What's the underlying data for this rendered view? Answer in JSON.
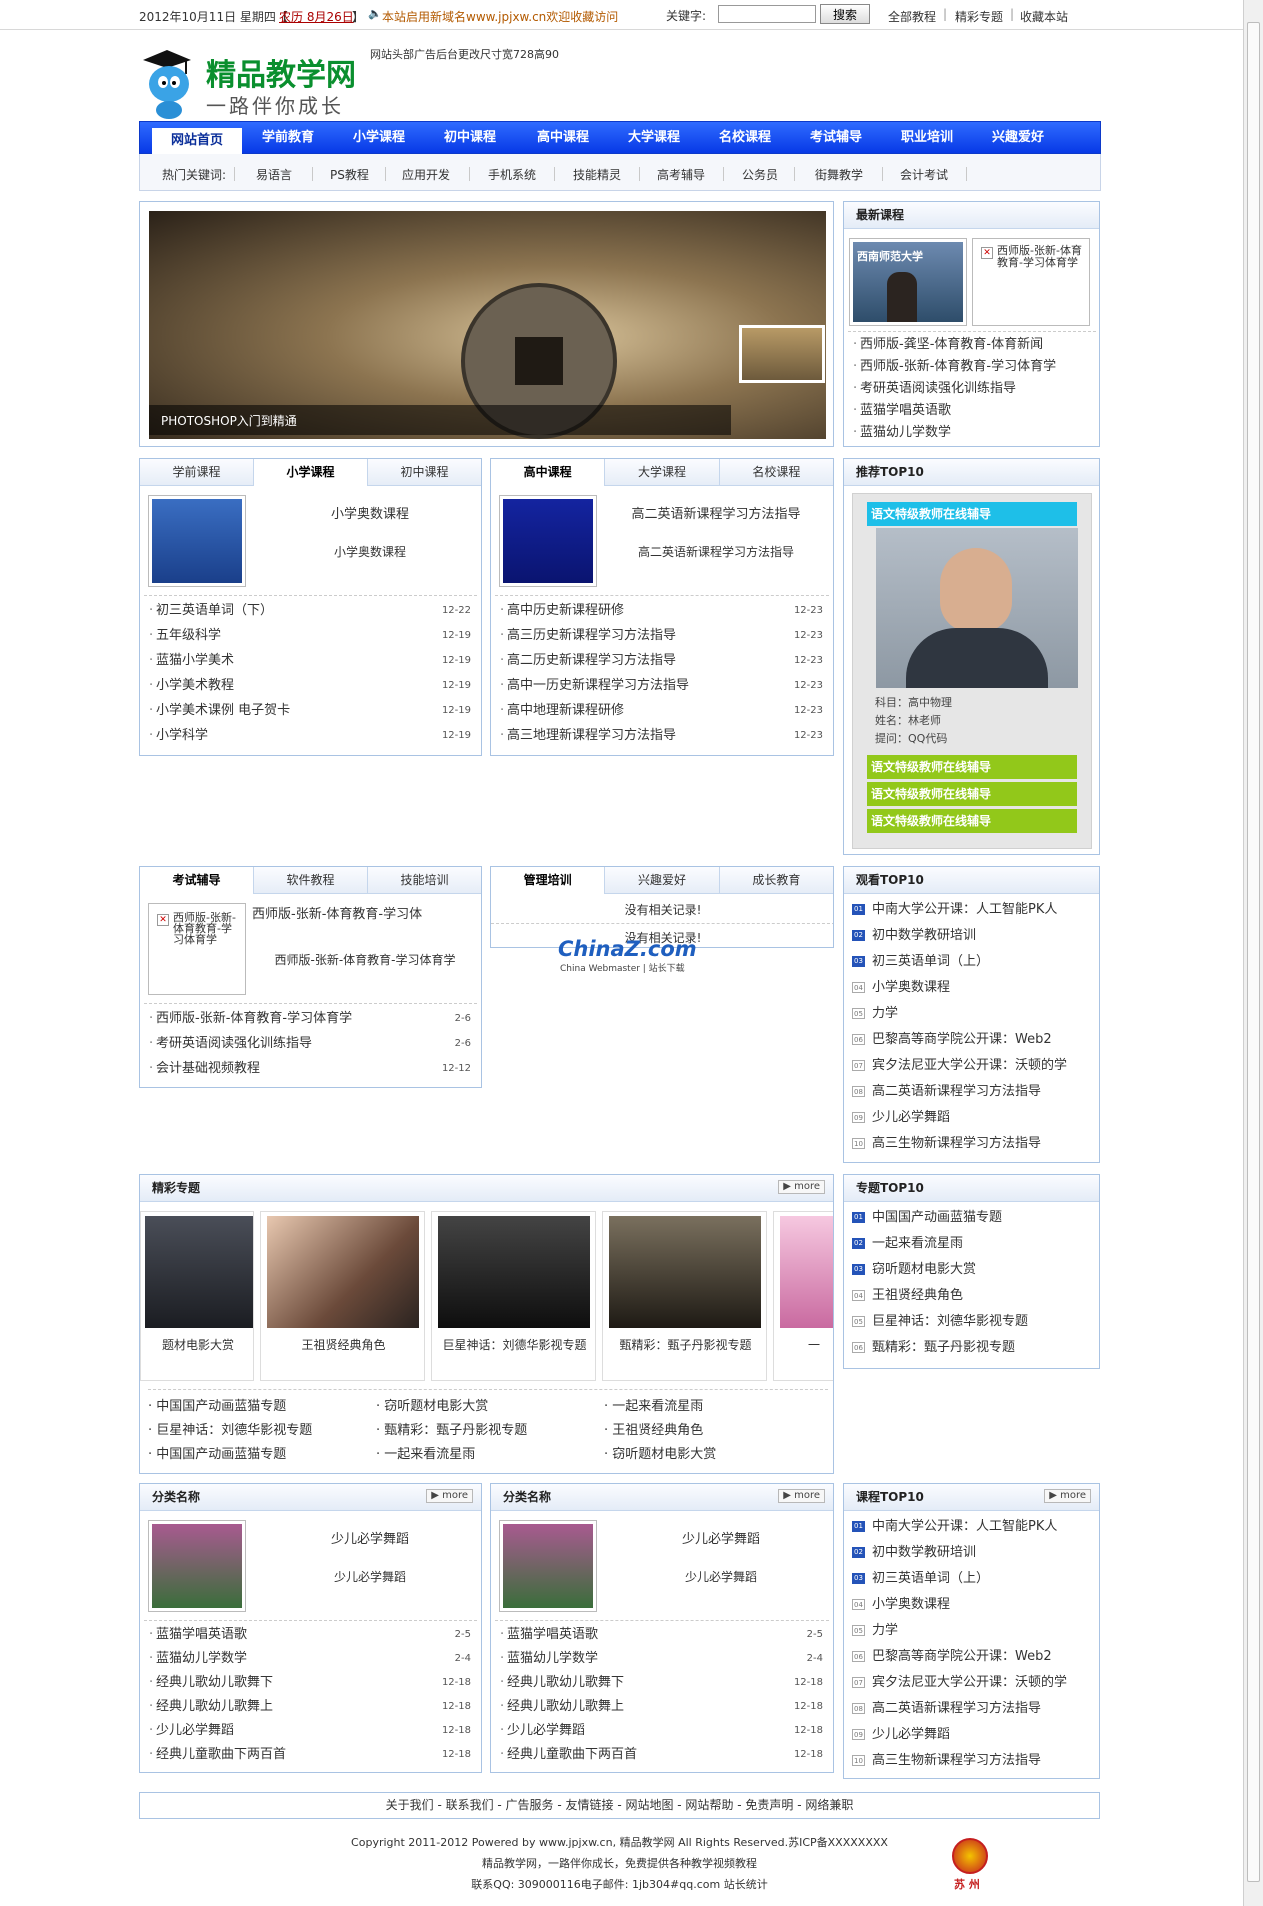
{
  "top": {
    "date": "2012年10月11日 星期四【",
    "lunar": "农历 8月26日",
    "lunar_end": "】",
    "notice": "本站启用新域名www.jpjxw.cn欢迎收藏访问",
    "kw_label": "关键字:",
    "search_btn": "搜索",
    "links": [
      "全部教程",
      "精彩专题",
      "收藏本站"
    ]
  },
  "header": {
    "logo_title": "精品教学网",
    "logo_slogan": "一路伴你成长",
    "ad_text": "网站头部广告后台更改尺寸宽728高90"
  },
  "nav": {
    "home": "网站首页",
    "items": [
      "学前教育",
      "小学课程",
      "初中课程",
      "高中课程",
      "大学课程",
      "名校课程",
      "考试辅导",
      "职业培训",
      "兴趣爱好"
    ]
  },
  "hot": {
    "label": "热门关键词:",
    "items": [
      "易语言",
      "PS教程",
      "应用开发",
      "手机系统",
      "技能精灵",
      "高考辅导",
      "公务员",
      "街舞教学",
      "会计考试"
    ]
  },
  "banner": {
    "caption": "PHOTOSHOP入门到精通"
  },
  "latest": {
    "title": "最新课程",
    "thumb1": "西南师范大学",
    "thumb2": "西师版-张新-体育教育-学习体育学",
    "items": [
      "西师版-龚坚-体育教育-体育新闻",
      "西师版-张新-体育教育-学习体育学",
      "考研英语阅读强化训练指导",
      "蓝猫学唱英语歌",
      "蓝猫幼儿学数学"
    ]
  },
  "box1": {
    "tabs": [
      "学前课程",
      "小学课程",
      "初中课程"
    ],
    "feat_title": "小学奥数课程",
    "feat_desc": "小学奥数课程",
    "rows": [
      [
        "初三英语单词（下）",
        "12-22"
      ],
      [
        "五年级科学",
        "12-19"
      ],
      [
        "蓝猫小学美术",
        "12-19"
      ],
      [
        "小学美术教程",
        "12-19"
      ],
      [
        "小学美术课例 电子贺卡",
        "12-19"
      ],
      [
        "小学科学",
        "12-19"
      ]
    ]
  },
  "box2": {
    "tabs": [
      "高中课程",
      "大学课程",
      "名校课程"
    ],
    "feat_title": "高二英语新课程学习方法指导",
    "feat_desc": "高二英语新课程学习方法指导",
    "rows": [
      [
        "高中历史新课程研修",
        "12-23"
      ],
      [
        "高三历史新课程学习方法指导",
        "12-23"
      ],
      [
        "高二历史新课程学习方法指导",
        "12-23"
      ],
      [
        "高中一历史新课程学习方法指导",
        "12-23"
      ],
      [
        "高中地理新课程研修",
        "12-23"
      ],
      [
        "高三地理新课程学习方法指导",
        "12-23"
      ]
    ]
  },
  "recommend": {
    "title": "推荐TOP10",
    "teacher_bar": "语文特级教师在线辅导",
    "info": [
      "科目：高中物理",
      "姓名：林老师",
      "提问：QQ代码"
    ],
    "green": [
      "语文特级教师在线辅导",
      "语文特级教师在线辅导",
      "语文特级教师在线辅导"
    ]
  },
  "box3": {
    "tabs": [
      "考试辅导",
      "软件教程",
      "技能培训"
    ],
    "thumb_text": "西师版-张新-体育教育-学习体育学",
    "feat_title": "西师版-张新-体育教育-学习体",
    "feat_desc": "西师版-张新-体育教育-学习体育学",
    "rows": [
      [
        "西师版-张新-体育教育-学习体育学",
        "2-6"
      ],
      [
        "考研英语阅读强化训练指导",
        "2-6"
      ],
      [
        "会计基础视频教程",
        "12-12"
      ]
    ]
  },
  "box4": {
    "tabs": [
      "管理培训",
      "兴趣爱好",
      "成长教育"
    ],
    "empty1": "没有相关记录!",
    "empty2": "没有相关记录!",
    "wm_main": "ChinaZ.com",
    "wm_sub": "China Webmaster | 站长下载"
  },
  "watch": {
    "title": "观看TOP10",
    "items": [
      "中南大学公开课：人工智能PK人",
      "初中数学教研培训",
      "初三英语单词（上）",
      "小学奥数课程",
      "力学",
      "巴黎高等商学院公开课：Web2",
      "宾夕法尼亚大学公开课：沃顿的学",
      "高二英语新课程学习方法指导",
      "少儿必学舞蹈",
      "高三生物新课程学习方法指导"
    ],
    "nums": [
      "01",
      "02",
      "03",
      "04",
      "05",
      "06",
      "07",
      "08",
      "09",
      "10"
    ]
  },
  "special": {
    "title": "精彩专题",
    "more": "more",
    "cards": [
      "题材电影大赏",
      "王祖贤经典角色",
      "巨星神话：刘德华影视专题",
      "甄精彩：甄子丹影视专题",
      "一"
    ],
    "links": [
      "中国国产动画蓝猫专题",
      "窃听题材电影大赏",
      "一起来看流星雨",
      "巨星神话：刘德华影视专题",
      "甄精彩：甄子丹影视专题",
      "王祖贤经典角色",
      "中国国产动画蓝猫专题",
      "一起来看流星雨",
      "窃听题材电影大赏"
    ]
  },
  "topic": {
    "title": "专题TOP10",
    "items": [
      "中国国产动画蓝猫专题",
      "一起来看流星雨",
      "窃听题材电影大赏",
      "王祖贤经典角色",
      "巨星神话：刘德华影视专题",
      "甄精彩：甄子丹影视专题"
    ],
    "nums": [
      "01",
      "02",
      "03",
      "04",
      "05",
      "06"
    ]
  },
  "cat1": {
    "title": "分类名称",
    "more": "more",
    "feat_title": "少儿必学舞蹈",
    "feat_desc": "少儿必学舞蹈",
    "rows": [
      [
        "蓝猫学唱英语歌",
        "2-5"
      ],
      [
        "蓝猫幼儿学数学",
        "2-4"
      ],
      [
        "经典儿歌幼儿歌舞下",
        "12-18"
      ],
      [
        "经典儿歌幼儿歌舞上",
        "12-18"
      ],
      [
        "少儿必学舞蹈",
        "12-18"
      ],
      [
        "经典儿童歌曲下两百首",
        "12-18"
      ]
    ]
  },
  "cat2": {
    "title": "分类名称",
    "more": "more",
    "feat_title": "少儿必学舞蹈",
    "feat_desc": "少儿必学舞蹈",
    "rows": [
      [
        "蓝猫学唱英语歌",
        "2-5"
      ],
      [
        "蓝猫幼儿学数学",
        "2-4"
      ],
      [
        "经典儿歌幼儿歌舞下",
        "12-18"
      ],
      [
        "经典儿歌幼儿歌舞上",
        "12-18"
      ],
      [
        "少儿必学舞蹈",
        "12-18"
      ],
      [
        "经典儿童歌曲下两百首",
        "12-18"
      ]
    ]
  },
  "course": {
    "title": "课程TOP10",
    "more": "more",
    "items": [
      "中南大学公开课：人工智能PK人",
      "初中数学教研培训",
      "初三英语单词（上）",
      "小学奥数课程",
      "力学",
      "巴黎高等商学院公开课：Web2",
      "宾夕法尼亚大学公开课：沃顿的学",
      "高二英语新课程学习方法指导",
      "少儿必学舞蹈",
      "高三生物新课程学习方法指导"
    ],
    "nums": [
      "01",
      "02",
      "03",
      "04",
      "05",
      "06",
      "07",
      "08",
      "09",
      "10"
    ]
  },
  "footer": {
    "links": "关于我们 - 联系我们 - 广告服务 - 友情链接 - 网站地图 - 网站帮助 - 免责声明 - 网络兼职",
    "copy": "Copyright 2011-2012 Powered by www.jpjxw.cn, 精品教学网 All Rights Reserved.苏ICP备XXXXXXXX",
    "slogan": "精品教学网，一路伴你成长，免费提供各种教学视频教程",
    "contact": "联系QQ: 309000116电子邮件: 1jb304#qq.com 站长统计",
    "badge": "苏 州"
  },
  "colors": {
    "nav_blue": "#0739e6",
    "border_blue": "#a9c3e3",
    "green": "#92c81a",
    "cyan": "#1ebfe8",
    "link_red": "#c00"
  }
}
